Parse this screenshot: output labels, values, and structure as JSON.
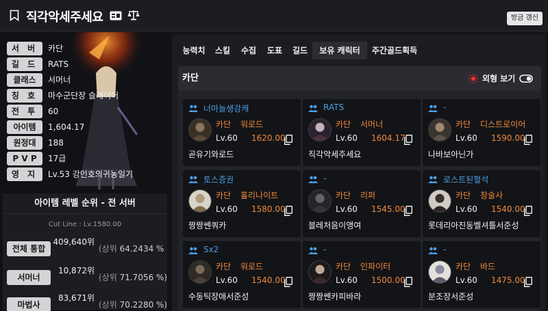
{
  "header": {
    "title": "직각악세주세요",
    "refresh_label": "방금 갱신"
  },
  "profile": [
    {
      "label": "서 버",
      "value": "카단"
    },
    {
      "label": "길 드",
      "value": "RATS"
    },
    {
      "label": "클래스",
      "value": "서머너"
    },
    {
      "label": "칭 호",
      "value": "마수군단장 슬레이어"
    },
    {
      "label": "전 투",
      "value": "60"
    },
    {
      "label": "아이템",
      "value": "1,604.17"
    },
    {
      "label": "원정대",
      "value": "188"
    },
    {
      "label": "P V P",
      "value": "17급"
    },
    {
      "label": "영 지",
      "value": "Lv.53 강인호의귀농일기"
    }
  ],
  "ranking": {
    "title": "아이템 레벨 순위 - 전 서버",
    "cutline": "Cut Line : Lv.1580.00",
    "rows": [
      {
        "label": "전체 통합",
        "rank": "409,640위",
        "prefix": "(상위",
        "pct": "64.2434 %"
      },
      {
        "label": "서머너",
        "rank": "10,872위",
        "prefix": "(상위",
        "pct": "71.7056 %)"
      },
      {
        "label": "마법사",
        "rank": "83,671위",
        "prefix": "(상위",
        "pct": "70.2280 %)"
      }
    ]
  },
  "tabs": [
    "능력치",
    "스킬",
    "수집",
    "도표",
    "길드",
    "보유 캐릭터",
    "주간골드획득"
  ],
  "active_tab": "보유 캐릭터",
  "characters_section": {
    "server": "카단",
    "outfit_label": "외형 보기"
  },
  "characters": [
    {
      "guild": "너마늘생강캐",
      "server": "카단",
      "class": "워로드",
      "level": "Lv.60",
      "item_level": "1620.00",
      "name": "곧유기와로드"
    },
    {
      "guild": "RATS",
      "server": "카단",
      "class": "서머너",
      "level": "Lv.60",
      "item_level": "1604.17",
      "name": "직각악세주세요"
    },
    {
      "guild": "-",
      "server": "카단",
      "class": "디스트로이어",
      "level": "Lv.60",
      "item_level": "1590.00",
      "name": "나바보아닌가"
    },
    {
      "guild": "토스증권",
      "server": "카단",
      "class": "홀리나이트",
      "level": "Lv.60",
      "item_level": "1580.00",
      "name": "짱짱쎈쿼카"
    },
    {
      "guild": "-",
      "server": "카단",
      "class": "리퍼",
      "level": "Lv.60",
      "item_level": "1545.00",
      "name": "블레처음이앵여"
    },
    {
      "guild": "로스트된혈석",
      "server": "카단",
      "class": "창술사",
      "level": "Lv.60",
      "item_level": "1540.00",
      "name": "롯데리아진동벨셔틀서준성"
    },
    {
      "guild": "Sx2",
      "server": "카단",
      "class": "워로드",
      "level": "Lv.60",
      "item_level": "1540.00",
      "name": "수동틱장애서준성"
    },
    {
      "guild": "-",
      "server": "카단",
      "class": "인파이터",
      "level": "Lv.60",
      "item_level": "1500.00",
      "name": "짱짱쎈카피바라"
    },
    {
      "guild": "-",
      "server": "카단",
      "class": "바드",
      "level": "Lv.60",
      "item_level": "1475.00",
      "name": "분조장서준성"
    }
  ],
  "colors": {
    "accent_orange": "#f08a3a",
    "guild_blue": "#4a9fe6",
    "sun_red": "#ff2a2a"
  },
  "icons": [
    "bookmark-icon",
    "id-card-icon",
    "scale-icon",
    "sun-icon",
    "toggle-icon",
    "group-icon",
    "copy-icon"
  ]
}
